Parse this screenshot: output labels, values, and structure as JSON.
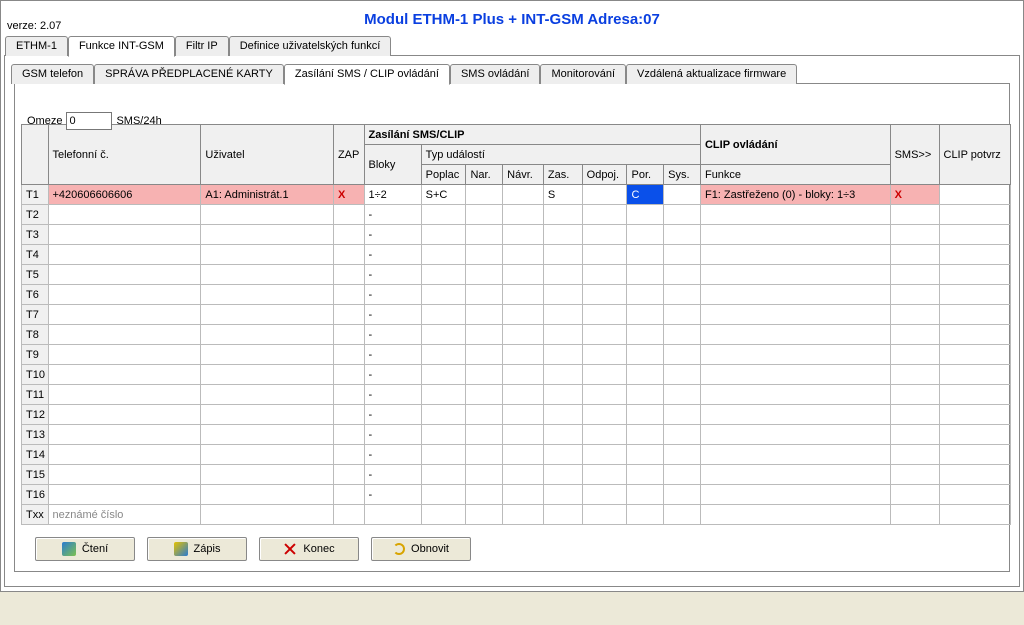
{
  "version_label": "verze: 2.07",
  "title": "Modul ETHM-1 Plus + INT-GSM Adresa:07",
  "top_tabs": [
    {
      "label": "ETHM-1",
      "active": false
    },
    {
      "label": "Funkce INT-GSM",
      "active": true
    },
    {
      "label": "Filtr IP",
      "active": false
    },
    {
      "label": "Definice uživatelských funkcí",
      "active": false
    }
  ],
  "sub_tabs": [
    {
      "label": "GSM telefon",
      "active": false
    },
    {
      "label": "SPRÁVA PŘEDPLACENÉ KARTY",
      "active": false
    },
    {
      "label": "Zasílání SMS / CLIP ovládání",
      "active": true
    },
    {
      "label": "SMS ovládání",
      "active": false
    },
    {
      "label": "Monitorování",
      "active": false
    },
    {
      "label": "Vzdálená aktualizace firmware",
      "active": false
    }
  ],
  "limit": {
    "label": "Omeze",
    "value": "0",
    "suffix": "SMS/24h"
  },
  "group_headers": {
    "smsclip_top": "Zasílání SMS/CLIP",
    "smsclip_sub": "Typ událostí",
    "clip": "CLIP ovládání"
  },
  "col_headers": {
    "phone": "Telefonní č.",
    "user": "Uživatel",
    "zap": "ZAP",
    "bloky": "Bloky",
    "poplac": "Poplac",
    "nar": "Nar.",
    "navr": "Návr.",
    "zas": "Zas.",
    "odpoj": "Odpoj.",
    "por": "Por.",
    "sys": "Sys.",
    "funkce": "Funkce",
    "sms": "SMS>>",
    "clip": "CLIP potvrz"
  },
  "row_labels": [
    "T1",
    "T2",
    "T3",
    "T4",
    "T5",
    "T6",
    "T7",
    "T8",
    "T9",
    "T10",
    "T11",
    "T12",
    "T13",
    "T14",
    "T15",
    "T16",
    "Txx"
  ],
  "unknown_number_placeholder": "neznámé číslo",
  "rows": [
    {
      "phone": "+420606606606",
      "user": "A1: Administrát.1",
      "zap": "X",
      "bloky": "1÷2",
      "poplac": "S+C",
      "nar": "",
      "navr": "",
      "zas": "S",
      "odpoj": "",
      "por": "C",
      "sys": "",
      "funkce": "F1: Zastřeženo (0) - bloky: 1÷3",
      "sms": "X",
      "clip": "",
      "pink": true,
      "sel_por": true
    },
    {
      "bloky": "-"
    },
    {
      "bloky": "-"
    },
    {
      "bloky": "-"
    },
    {
      "bloky": "-"
    },
    {
      "bloky": "-"
    },
    {
      "bloky": "-"
    },
    {
      "bloky": "-"
    },
    {
      "bloky": "-"
    },
    {
      "bloky": "-"
    },
    {
      "bloky": "-"
    },
    {
      "bloky": "-"
    },
    {
      "bloky": "-"
    },
    {
      "bloky": "-"
    },
    {
      "bloky": "-"
    },
    {
      "bloky": "-"
    },
    {
      "phone_placeholder": true
    }
  ],
  "buttons": {
    "read": "Čtení",
    "write": "Zápis",
    "close": "Konec",
    "refresh": "Obnovit"
  }
}
